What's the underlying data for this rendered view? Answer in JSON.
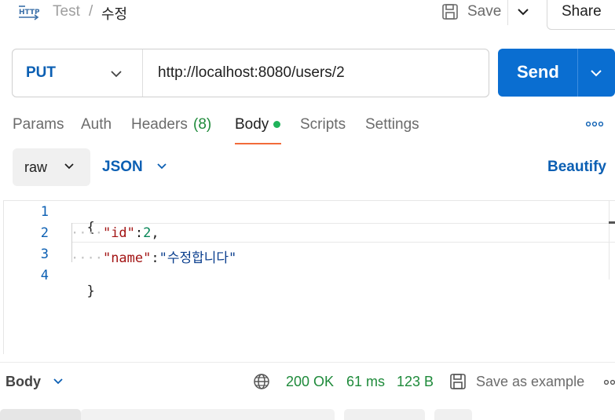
{
  "header": {
    "collection": "Test",
    "separator": "/",
    "request_name": "수정",
    "save_label": "Save",
    "share_label": "Share"
  },
  "request": {
    "method": "PUT",
    "url": "http://localhost:8080/users/2",
    "send_label": "Send"
  },
  "tabs": [
    {
      "label": "Params"
    },
    {
      "label": "Auth"
    },
    {
      "label": "Headers",
      "count": "(8)"
    },
    {
      "label": "Body",
      "active": true
    },
    {
      "label": "Scripts"
    },
    {
      "label": "Settings"
    }
  ],
  "body_options": {
    "mode": "raw",
    "language": "JSON",
    "beautify_label": "Beautify"
  },
  "editor": {
    "line_numbers": [
      "1",
      "2",
      "3",
      "4"
    ],
    "lines": [
      {
        "open": "{"
      },
      {
        "indent": "····",
        "key": "\"id\"",
        "colon": ":",
        "value": "2",
        "comma": ","
      },
      {
        "indent": "····",
        "key": "\"name\"",
        "colon": ":",
        "value": "\"수정합니다\""
      },
      {
        "close": "}"
      }
    ]
  },
  "response": {
    "label": "Body",
    "status": "200 OK",
    "time": "61 ms",
    "size": "123 B",
    "save_example_label": "Save as example"
  },
  "colors": {
    "accent": "#0a6ed1",
    "method": "#0b5fb3",
    "success": "#1e8a3a",
    "active_tab_underline": "#f26b3a",
    "body_dot": "#1fb35a"
  },
  "icons": [
    "http-icon",
    "save-icon",
    "chevron-down-icon",
    "more-horizontal-icon",
    "globe-icon"
  ]
}
